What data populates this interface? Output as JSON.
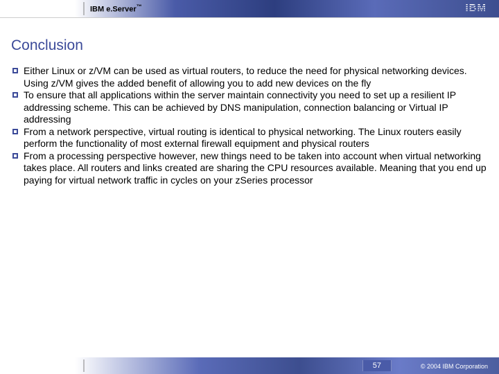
{
  "header": {
    "brand_prefix": "IBM e.",
    "brand_product": "Server",
    "brand_tm": "™",
    "logo_alt": "IBM"
  },
  "slide": {
    "title": "Conclusion",
    "bullets": [
      "Either Linux or z/VM can be used as virtual routers, to reduce the need for physical networking devices.  Using z/VM gives the added benefit of allowing you to add new devices on the fly",
      "To ensure that all applications within the server maintain connectivity you need to set up a resilient IP addressing scheme.  This can be achieved by DNS manipulation, connection balancing or Virtual IP addressing",
      "From a network perspective, virtual routing is identical to physical networking.  The Linux routers easily perform the functionality of most external firewall equipment and physical routers",
      "From a processing perspective however, new things need to be taken into account when virtual networking takes place.  All routers and links created are sharing the CPU resources available.  Meaning that you end up paying for virtual network traffic in cycles on your zSeries processor"
    ]
  },
  "footer": {
    "page_number": "57",
    "copyright": "© 2004 IBM Corporation"
  }
}
